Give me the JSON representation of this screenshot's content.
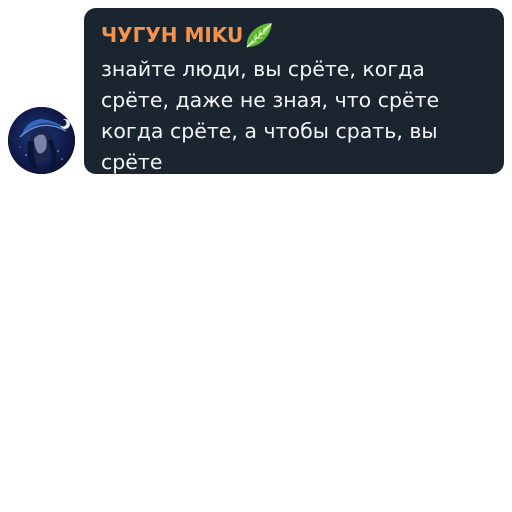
{
  "message": {
    "sender": {
      "name": "ЧУГУН MIKU",
      "name_color": "#f4944c",
      "badge_icon": "lettuce-emoji-icon"
    },
    "avatar": {
      "icon": "anime-character-avatar"
    },
    "text": "знайте люди, вы срёте, когда\nсрёте, даже не зная, что срёте\nкогда срёте, а чтобы срать, вы\nсрёте",
    "bubble_color": "#1a2530",
    "text_color": "#f2f4f6"
  }
}
